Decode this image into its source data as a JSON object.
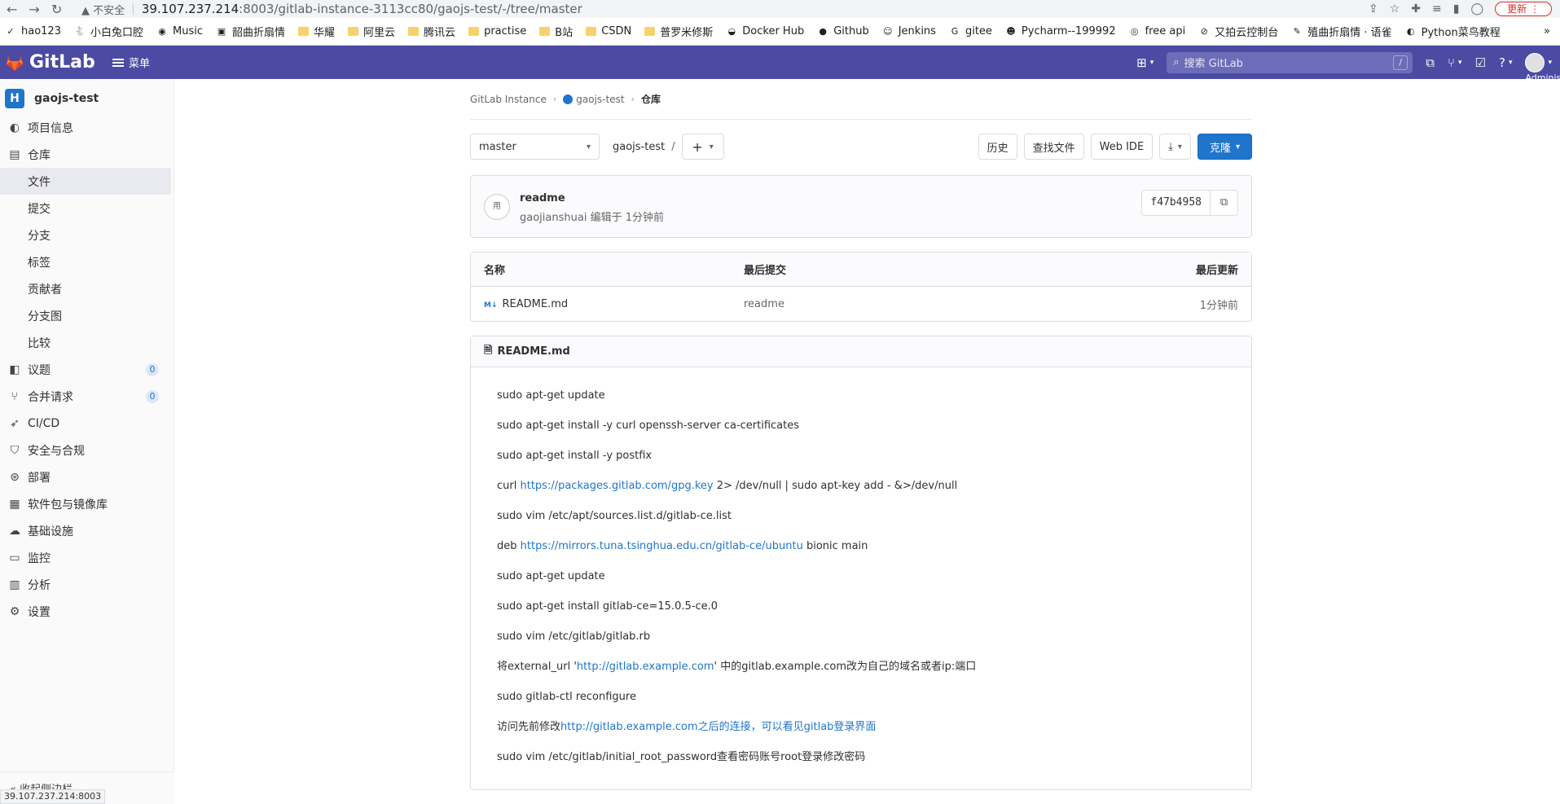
{
  "browser": {
    "insecure_label": "不安全",
    "url_host": "39.107.237.214",
    "url_rest": ":8003/gitlab-instance-3113cc80/gaojs-test/-/tree/master",
    "update_label": "更新",
    "status_url": "39.107.237.214:8003",
    "bookmarks": [
      {
        "label": "hao123",
        "icon": "hao123-icon"
      },
      {
        "label": "小白兔口腔",
        "icon": "rabbit-icon"
      },
      {
        "label": "Music",
        "icon": "netease-icon"
      },
      {
        "label": "韶曲折扇情",
        "icon": "book-icon"
      },
      {
        "label": "华耀",
        "icon": "folder-icon"
      },
      {
        "label": "阿里云",
        "icon": "folder-icon"
      },
      {
        "label": "腾讯云",
        "icon": "folder-icon"
      },
      {
        "label": "practise",
        "icon": "folder-icon"
      },
      {
        "label": "B站",
        "icon": "folder-icon"
      },
      {
        "label": "CSDN",
        "icon": "folder-icon"
      },
      {
        "label": "普罗米修斯",
        "icon": "folder-icon"
      },
      {
        "label": "Docker Hub",
        "icon": "docker-icon"
      },
      {
        "label": "Github",
        "icon": "github-icon"
      },
      {
        "label": "Jenkins",
        "icon": "jenkins-icon"
      },
      {
        "label": "gitee",
        "icon": "gitee-icon"
      },
      {
        "label": "Pycharm--199992",
        "icon": "user-icon"
      },
      {
        "label": "free api",
        "icon": "api-icon"
      },
      {
        "label": "又拍云控制台",
        "icon": "upyun-icon"
      },
      {
        "label": "殖曲折扇情 · 语雀",
        "icon": "yuque-icon"
      },
      {
        "label": "Python菜鸟教程",
        "icon": "runoob-icon"
      }
    ],
    "bookmarks_more": "»"
  },
  "header": {
    "logo_text": "GitLab",
    "menu_label": "菜单",
    "search_placeholder": "搜索 GitLab",
    "search_shortcut": "/",
    "user_label": "Administrat"
  },
  "sidebar": {
    "project_initial": "H",
    "project_name": "gaojs-test",
    "items": [
      {
        "label": "项目信息",
        "icon": "info-icon",
        "level": "top"
      },
      {
        "label": "仓库",
        "icon": "doc-icon",
        "level": "top"
      },
      {
        "label": "文件",
        "level": "sub",
        "active": true
      },
      {
        "label": "提交",
        "level": "sub"
      },
      {
        "label": "分支",
        "level": "sub"
      },
      {
        "label": "标签",
        "level": "sub"
      },
      {
        "label": "贡献者",
        "level": "sub"
      },
      {
        "label": "分支图",
        "level": "sub"
      },
      {
        "label": "比较",
        "level": "sub"
      },
      {
        "label": "议题",
        "icon": "issues-icon",
        "level": "top",
        "count": "0"
      },
      {
        "label": "合并请求",
        "icon": "merge-request-icon",
        "level": "top",
        "count": "0"
      },
      {
        "label": "CI/CD",
        "icon": "rocket-icon",
        "level": "top"
      },
      {
        "label": "安全与合规",
        "icon": "shield-icon",
        "level": "top"
      },
      {
        "label": "部署",
        "icon": "deploy-icon",
        "level": "top"
      },
      {
        "label": "软件包与镜像库",
        "icon": "package-icon",
        "level": "top"
      },
      {
        "label": "基础设施",
        "icon": "cloud-icon",
        "level": "top"
      },
      {
        "label": "监控",
        "icon": "monitor-icon",
        "level": "top"
      },
      {
        "label": "分析",
        "icon": "chart-icon",
        "level": "top"
      },
      {
        "label": "设置",
        "icon": "gear-icon",
        "level": "top"
      }
    ],
    "collapse_label": "收起侧边栏"
  },
  "breadcrumb": {
    "items": [
      "GitLab Instance",
      "gaojs-test",
      "仓库"
    ]
  },
  "toolbar": {
    "branch": "master",
    "path_root": "gaojs-test",
    "path_sep": "/",
    "history_label": "历史",
    "find_file_label": "查找文件",
    "web_ide_label": "Web IDE",
    "clone_label": "克隆"
  },
  "commit": {
    "avatar_alt": "用",
    "title": "readme",
    "meta": "gaojianshuai 编辑于 1分钟前",
    "sha": "f47b4958"
  },
  "file_table": {
    "headers": [
      "名称",
      "最后提交",
      "最后更新"
    ],
    "rows": [
      {
        "name": "README.md",
        "commit": "readme",
        "updated": "1分钟前"
      }
    ]
  },
  "readme": {
    "title": "README.md",
    "lines": [
      {
        "parts": [
          {
            "t": "sudo apt-get update"
          }
        ]
      },
      {
        "parts": [
          {
            "t": "sudo apt-get install -y curl openssh-server ca-certificates"
          }
        ]
      },
      {
        "parts": [
          {
            "t": "sudo apt-get install -y postfix"
          }
        ]
      },
      {
        "parts": [
          {
            "t": "curl "
          },
          {
            "t": "https://packages.gitlab.com/gpg.key",
            "link": true
          },
          {
            "t": " 2> /dev/null | sudo apt-key add - &>/dev/null"
          }
        ]
      },
      {
        "parts": [
          {
            "t": "sudo vim /etc/apt/sources.list.d/gitlab-ce.list"
          }
        ]
      },
      {
        "parts": [
          {
            "t": "deb "
          },
          {
            "t": "https://mirrors.tuna.tsinghua.edu.cn/gitlab-ce/ubuntu",
            "link": true
          },
          {
            "t": " bionic main"
          }
        ]
      },
      {
        "parts": [
          {
            "t": "sudo apt-get update"
          }
        ]
      },
      {
        "parts": [
          {
            "t": "sudo apt-get install gitlab-ce=15.0.5-ce.0"
          }
        ]
      },
      {
        "parts": [
          {
            "t": "sudo vim /etc/gitlab/gitlab.rb"
          }
        ]
      },
      {
        "parts": [
          {
            "t": "将external_url '"
          },
          {
            "t": "http://gitlab.example.com",
            "link": true
          },
          {
            "t": "' 中的gitlab.example.com改为自己的域名或者ip:端口"
          }
        ]
      },
      {
        "parts": [
          {
            "t": "sudo gitlab-ctl reconfigure"
          }
        ]
      },
      {
        "parts": [
          {
            "t": "访问先前修改"
          },
          {
            "t": "http://gitlab.example.com之后的连接，可以看见gitlab登录界面",
            "link": true
          }
        ]
      },
      {
        "parts": [
          {
            "t": "sudo vim /etc/gitlab/initial_root_password查看密码账号root登录修改密码"
          }
        ]
      }
    ]
  },
  "colors": {
    "header_bg": "#4b4ba3",
    "accent": "#1f75cb",
    "sidebar_bg": "#fafafa"
  }
}
